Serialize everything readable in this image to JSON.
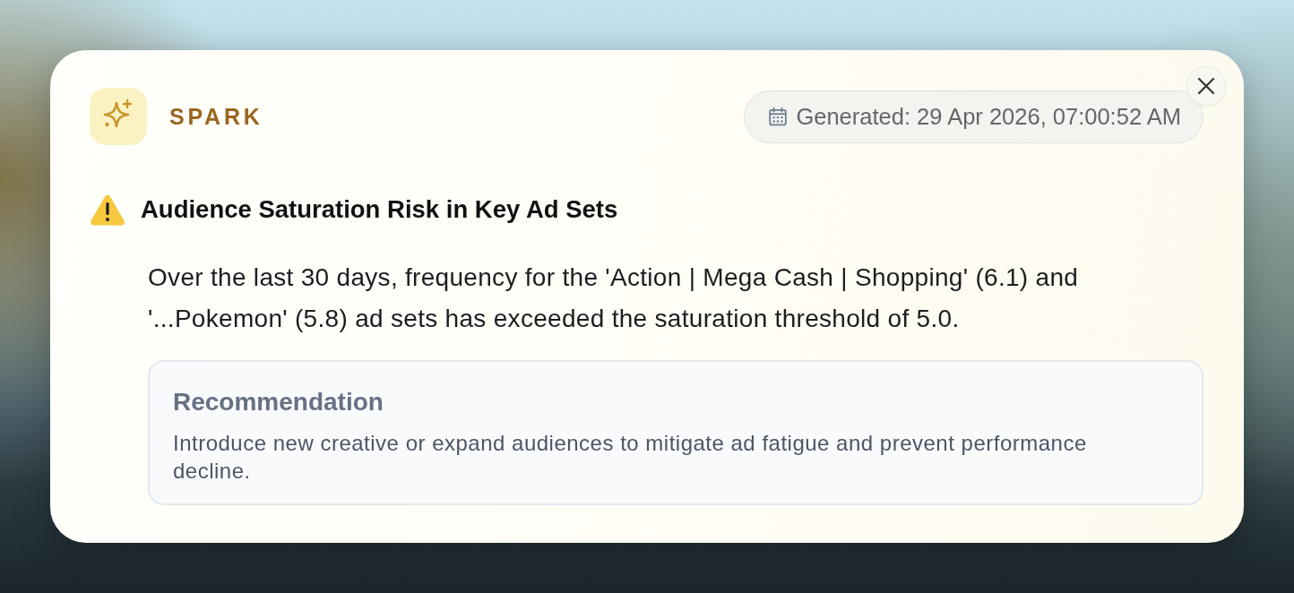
{
  "brand": {
    "name": "SPARK"
  },
  "generated": {
    "text": "Generated: 29 Apr 2026, 07:00:52 AM"
  },
  "insight": {
    "kind": "warning",
    "title": "Audience Saturation Risk in Key Ad Sets",
    "body": "Over the last 30 days, frequency for the 'Action | Mega Cash | Shopping' (6.1) and '...Pokemon' (5.8) ad sets has exceeded the saturation threshold of 5.0."
  },
  "recommendation": {
    "title": "Recommendation",
    "text": "Introduce new creative or expand audiences to mitigate ad fatigue and prevent performance decline."
  }
}
